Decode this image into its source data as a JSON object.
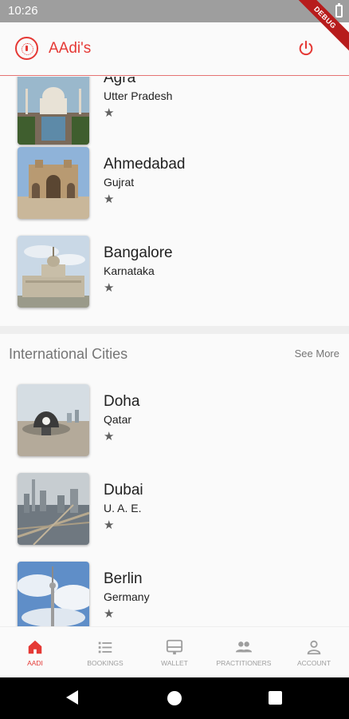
{
  "status_bar": {
    "time": "10:26"
  },
  "debug_banner": "DEBUG",
  "app_bar": {
    "title": "AAdi's"
  },
  "domestic_cities": [
    {
      "name": "Agra",
      "state": "Utter Pradesh",
      "rating_icon": "★"
    },
    {
      "name": "Ahmedabad",
      "state": "Gujrat",
      "rating_icon": "★"
    },
    {
      "name": "Bangalore",
      "state": "Karnataka",
      "rating_icon": "★"
    }
  ],
  "international": {
    "title": "International Cities",
    "see_more": "See More",
    "cities": [
      {
        "name": "Doha",
        "state": "Qatar",
        "rating_icon": "★"
      },
      {
        "name": "Dubai",
        "state": "U. A. E.",
        "rating_icon": "★"
      },
      {
        "name": "Berlin",
        "state": "Germany",
        "rating_icon": "★"
      }
    ]
  },
  "bottom_nav": [
    {
      "label": "AADI",
      "icon": "home-icon",
      "active": true
    },
    {
      "label": "BOOKINGS",
      "icon": "list-icon",
      "active": false
    },
    {
      "label": "WALLET",
      "icon": "wallet-icon",
      "active": false
    },
    {
      "label": "PRACTITIONERS",
      "icon": "people-icon",
      "active": false
    },
    {
      "label": "ACCOUNT",
      "icon": "person-icon",
      "active": false
    }
  ],
  "colors": {
    "accent": "#e53935",
    "inactive": "#9e9e9e",
    "status_bar": "#9e9e9e"
  }
}
